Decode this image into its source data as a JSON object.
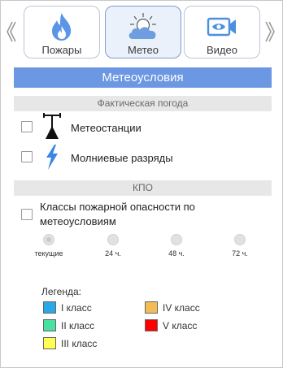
{
  "tabs": [
    {
      "label": "Пожары",
      "icon": "flame-icon"
    },
    {
      "label": "Метео",
      "icon": "sun-cloud-icon",
      "active": true
    },
    {
      "label": "Видео",
      "icon": "video-camera-icon"
    }
  ],
  "nav": {
    "prev_icon": "chevron-left-icon",
    "next_icon": "chevron-right-icon"
  },
  "header": {
    "title": "Метеоусловия"
  },
  "actual_weather": {
    "title": "Фактическая погода",
    "items": [
      {
        "label": "Метеостанции",
        "icon": "weather-station-icon",
        "checked": false
      },
      {
        "label": "Молниевые разряды",
        "icon": "lightning-icon",
        "checked": false
      }
    ]
  },
  "kpo": {
    "title": "КПО",
    "checkbox_label": "Классы пожарной опасности по метеоусловиям",
    "checked": false,
    "periods": [
      {
        "label": "текущие",
        "selected": true
      },
      {
        "label": "24 ч.",
        "selected": false
      },
      {
        "label": "48 ч.",
        "selected": false
      },
      {
        "label": "72 ч.",
        "selected": false
      }
    ]
  },
  "legend": {
    "title": "Легенда:",
    "items": [
      {
        "label": "I класс",
        "color": "#2aa8e6"
      },
      {
        "label": "II класс",
        "color": "#49e0a0"
      },
      {
        "label": "III класс",
        "color": "#ffff55"
      },
      {
        "label": "IV класс",
        "color": "#f2bd55"
      },
      {
        "label": "V класс",
        "color": "#ff0000"
      }
    ]
  },
  "colors": {
    "accent": "#6c97e2",
    "tab_active_bg": "#eaf1fb",
    "icon_blue": "#4a90e2"
  }
}
